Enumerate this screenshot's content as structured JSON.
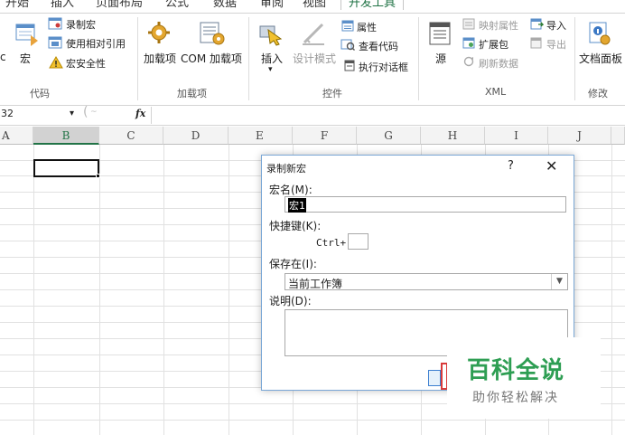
{
  "ribbon_tabs": [
    "开始",
    "插入",
    "页面布局",
    "公式",
    "数据",
    "审阅",
    "视图",
    "开发工具"
  ],
  "active_tab": "开发工具",
  "ribbon": {
    "code": {
      "partial_label": "c",
      "macros_label": "宏",
      "record_macro": "录制宏",
      "use_relative": "使用相对引用",
      "macro_security": "宏安全性",
      "group_label": "代码"
    },
    "addins": {
      "addins_label": "加载项",
      "com_addins_label": "COM 加载项",
      "group_label": "加载项"
    },
    "controls": {
      "insert_label": "插入",
      "design_mode_label": "设计模式",
      "properties_label": "属性",
      "view_code_label": "查看代码",
      "run_dialog_label": "执行对话框",
      "group_label": "控件"
    },
    "xml": {
      "source_label": "源",
      "map_properties_label": "映射属性",
      "expansion_packs_label": "扩展包",
      "refresh_data_label": "刷新数据",
      "import_label": "导入",
      "export_label": "导出",
      "group_label": "XML"
    },
    "modify": {
      "doc_panel_label": "文档面板",
      "group_label": "修改"
    }
  },
  "formula_bar": {
    "name_box": "32",
    "fx_label": "fx"
  },
  "columns": [
    "A",
    "B",
    "C",
    "D",
    "E",
    "F",
    "G",
    "H",
    "I",
    "J"
  ],
  "selected_column": "B",
  "dialog": {
    "title": "录制新宏",
    "help": "?",
    "close": "✕",
    "macro_name_label": "宏名(M):",
    "macro_name_value": "宏1",
    "shortcut_label": "快捷键(K):",
    "ctrl_prefix": "Ctrl+",
    "shortcut_value": "",
    "store_in_label": "保存在(I):",
    "store_in_value": "当前工作簿",
    "description_label": "说明(D):",
    "description_value": ""
  },
  "watermark": {
    "main": "百科全说",
    "sub": "助你轻松解决"
  }
}
